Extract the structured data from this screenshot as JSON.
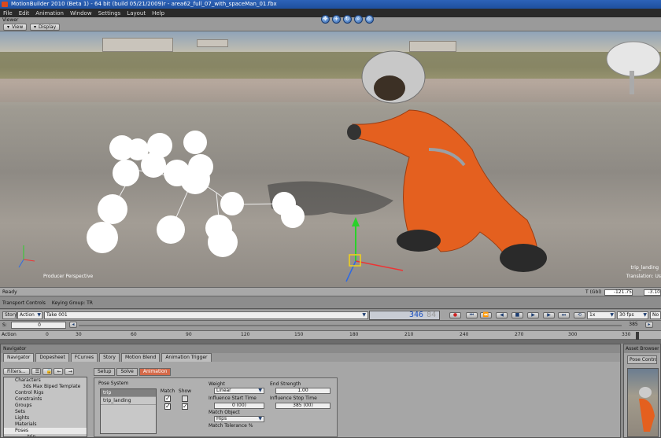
{
  "window": {
    "title": "MotionBuilder 2010 (Beta 1)  - 64 bit (build 05/21/2009)r - area62_full_07_with_spaceMan_01.fbx"
  },
  "menu": {
    "items": [
      "File",
      "Edit",
      "Animation",
      "Window",
      "Settings",
      "Layout",
      "Help"
    ]
  },
  "viewer": {
    "label": "Viewer",
    "view_button": "View",
    "display_button": "Display",
    "camera_label": "Producer Perspective",
    "character_label": "trip_landing",
    "translation_label": "Translation: Us"
  },
  "status": {
    "text": "Ready",
    "t_label": "T (Gbl)",
    "t_value": "-121.75",
    "second_value": "-3.10"
  },
  "transport": {
    "header_label": "Transport Controls",
    "keying_label": "Keying Group: TR",
    "story_button": "Story",
    "action_dropdown": "Action",
    "take": "Take 001",
    "timecode_main": "346",
    "timecode_dim": "84",
    "speed": "1x",
    "fps": "30 fps",
    "snap": "No S",
    "start_label": "S:",
    "start_value": "0",
    "end_value": "385",
    "track_label": "Action",
    "ruler": [
      "0",
      "30",
      "60",
      "90",
      "120",
      "150",
      "180",
      "210",
      "240",
      "270",
      "300",
      "330"
    ]
  },
  "navigator": {
    "title": "Navigator",
    "tabs": [
      "Navigator",
      "Dopesheet",
      "FCurves",
      "Story",
      "Motion Blend",
      "Animation Trigger"
    ],
    "filters_label": "Filters...",
    "tree": [
      {
        "label": "Characters",
        "indent": 1
      },
      {
        "label": "3ds Max Biped Template",
        "indent": 2
      },
      {
        "label": "Control Rigs",
        "indent": 1
      },
      {
        "label": "Constraints",
        "indent": 1
      },
      {
        "label": "Groups",
        "indent": 1
      },
      {
        "label": "Sets",
        "indent": 1
      },
      {
        "label": "Lights",
        "indent": 1
      },
      {
        "label": "Materials",
        "indent": 1
      },
      {
        "label": "Poses",
        "indent": 1
      },
      {
        "label": "trip",
        "indent": 2
      }
    ],
    "sub_tabs": [
      "Setup",
      "Solve",
      "Animation"
    ],
    "pose_system_label": "Pose System",
    "poses": [
      "trip",
      "trip_landing"
    ],
    "match_header": "Match",
    "show_header": "Show",
    "weight_label": "Weight",
    "weight_value": "Linear",
    "end_strength_label": "End Strength",
    "end_strength_value": "1.00",
    "influence_start_label": "Influence Start Time",
    "influence_start_value": "0 (00)",
    "influence_stop_label": "Influence Stop Time",
    "influence_stop_value": "385 (00)",
    "match_object_label": "Match Object",
    "match_object_value": "Hips",
    "match_tolerance_label": "Match Tolerance %"
  },
  "asset_browser": {
    "title": "Asset Browser",
    "tab": "Pose Controls"
  }
}
